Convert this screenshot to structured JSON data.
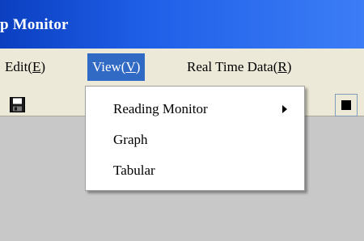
{
  "window": {
    "title": "p Monitor"
  },
  "menubar": {
    "items": [
      {
        "label": "Edit(",
        "accel": "E",
        "close": ")"
      },
      {
        "label": "View(",
        "accel": "V",
        "close": ")"
      },
      {
        "label": "Real Time Data(",
        "accel": "R",
        "close": ")"
      }
    ]
  },
  "view_menu": {
    "items": [
      {
        "label": "Reading Monitor",
        "has_submenu": true
      },
      {
        "label": "Graph"
      },
      {
        "label": "Tabular"
      }
    ]
  },
  "toolbar": {
    "icons": [
      "save-icon",
      "stop-icon"
    ]
  },
  "colors": {
    "titlebar": "#1f5fe8",
    "menu_highlight": "#316ac5",
    "chrome": "#ece9d8",
    "client": "#c8c8c8"
  }
}
